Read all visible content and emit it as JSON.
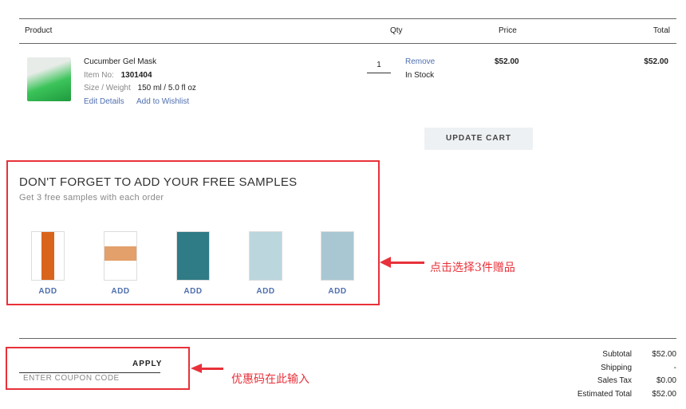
{
  "header": {
    "product": "Product",
    "qty": "Qty",
    "price": "Price",
    "total": "Total"
  },
  "item": {
    "name": "Cucumber Gel Mask",
    "item_no_label": "Item No:",
    "item_no": "1301404",
    "size_label": "Size / Weight",
    "size": "150 ml / 5.0 fl oz",
    "edit": "Edit Details",
    "wishlist": "Add to Wishlist",
    "qty": "1",
    "remove": "Remove",
    "stock": "In Stock",
    "price": "$52.00",
    "total": "$52.00"
  },
  "update_cart": "UPDATE CART",
  "samples": {
    "title": "DON'T FORGET TO ADD YOUR FREE SAMPLES",
    "subtitle": "Get 3 free samples with each order",
    "add_label": "ADD",
    "items": [
      {
        "add": "ADD",
        "color": "#d9651c"
      },
      {
        "add": "ADD",
        "color": "#e3a06a"
      },
      {
        "add": "ADD",
        "color": "#2f7b86"
      },
      {
        "add": "ADD",
        "color": "#bcd6de"
      },
      {
        "add": "ADD",
        "color": "#a9c7d2"
      }
    ]
  },
  "annotations": {
    "samples_note": "点击选择3件赠品",
    "coupon_note": "优惠码在此输入",
    "accent": "#e8313a"
  },
  "coupon": {
    "apply": "APPLY",
    "placeholder": "ENTER COUPON CODE"
  },
  "summary": {
    "subtotal_label": "Subtotal",
    "subtotal": "$52.00",
    "shipping_label": "Shipping",
    "shipping": "-",
    "tax_label": "Sales Tax",
    "tax": "$0.00",
    "total_label": "Estimated Total",
    "total": "$52.00"
  }
}
